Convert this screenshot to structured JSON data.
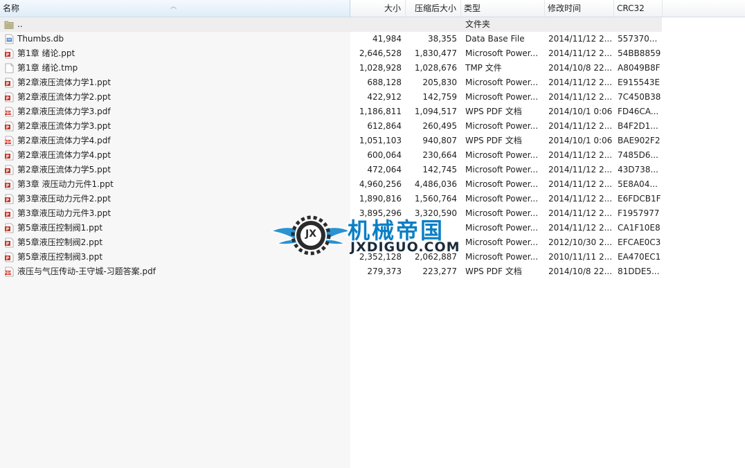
{
  "columns": {
    "name": "名称",
    "size": "大小",
    "packed": "压缩后大小",
    "type": "类型",
    "modified": "修改时间",
    "crc": "CRC32"
  },
  "parent_row": {
    "name": "..",
    "type": "文件夹",
    "icon": "folder-icon"
  },
  "files": [
    {
      "name": "Thumbs.db",
      "size": "41,984",
      "packed": "38,355",
      "type": "Data Base File",
      "modified": "2014/11/12 2...",
      "crc": "557370...",
      "icon": "db-file-icon"
    },
    {
      "name": "第1章  绪论.ppt",
      "size": "2,646,528",
      "packed": "1,830,477",
      "type": "Microsoft Power...",
      "modified": "2014/11/12 2...",
      "crc": "54BB8859",
      "icon": "ppt-file-icon"
    },
    {
      "name": "第1章  绪论.tmp",
      "size": "1,028,928",
      "packed": "1,028,676",
      "type": "TMP 文件",
      "modified": "2014/10/8 22...",
      "crc": "A8049B8F",
      "icon": "blank-file-icon"
    },
    {
      "name": "第2章液压流体力学1.ppt",
      "size": "688,128",
      "packed": "205,830",
      "type": "Microsoft Power...",
      "modified": "2014/11/12 2...",
      "crc": "E915543E",
      "icon": "ppt-file-icon"
    },
    {
      "name": "第2章液压流体力学2.ppt",
      "size": "422,912",
      "packed": "142,759",
      "type": "Microsoft Power...",
      "modified": "2014/11/12 2...",
      "crc": "7C450B38",
      "icon": "ppt-file-icon"
    },
    {
      "name": "第2章液压流体力学3.pdf",
      "size": "1,186,811",
      "packed": "1,094,517",
      "type": "WPS PDF 文档",
      "modified": "2014/10/1 0:06",
      "crc": "FD46CA...",
      "icon": "pdf-file-icon"
    },
    {
      "name": "第2章液压流体力学3.ppt",
      "size": "612,864",
      "packed": "260,495",
      "type": "Microsoft Power...",
      "modified": "2014/11/12 2...",
      "crc": "B4F2D1...",
      "icon": "ppt-file-icon"
    },
    {
      "name": "第2章液压流体力学4.pdf",
      "size": "1,051,103",
      "packed": "940,807",
      "type": "WPS PDF 文档",
      "modified": "2014/10/1 0:06",
      "crc": "BAE902F2",
      "icon": "pdf-file-icon"
    },
    {
      "name": "第2章液压流体力学4.ppt",
      "size": "600,064",
      "packed": "230,664",
      "type": "Microsoft Power...",
      "modified": "2014/11/12 2...",
      "crc": "7485D6...",
      "icon": "ppt-file-icon"
    },
    {
      "name": "第2章液压流体力学5.ppt",
      "size": "472,064",
      "packed": "142,745",
      "type": "Microsoft Power...",
      "modified": "2014/11/12 2...",
      "crc": "43D738...",
      "icon": "ppt-file-icon"
    },
    {
      "name": "第3章 液压动力元件1.ppt",
      "size": "4,960,256",
      "packed": "4,486,036",
      "type": "Microsoft Power...",
      "modified": "2014/11/12 2...",
      "crc": "5E8A04...",
      "icon": "ppt-file-icon"
    },
    {
      "name": "第3章液压动力元件2.ppt",
      "size": "1,890,816",
      "packed": "1,560,764",
      "type": "Microsoft Power...",
      "modified": "2014/11/12 2...",
      "crc": "E6FDCB1F",
      "icon": "ppt-file-icon"
    },
    {
      "name": "第3章液压动力元件3.ppt",
      "size": "3,895,296",
      "packed": "3,320,590",
      "type": "Microsoft Power...",
      "modified": "2014/11/12 2...",
      "crc": "F1957977",
      "icon": "ppt-file-icon"
    },
    {
      "name": "第5章液压控制阀1.ppt",
      "size": "",
      "packed": "",
      "type": "Microsoft Power...",
      "modified": "2014/11/12 2...",
      "crc": "CA1F10E8",
      "icon": "ppt-file-icon"
    },
    {
      "name": "第5章液压控制阀2.ppt",
      "size": "",
      "packed": "",
      "type": "Microsoft Power...",
      "modified": "2012/10/30 2...",
      "crc": "EFCAE0C3",
      "icon": "ppt-file-icon"
    },
    {
      "name": "第5章液压控制阀3.ppt",
      "size": "2,352,128",
      "packed": "2,062,887",
      "type": "Microsoft Power...",
      "modified": "2010/11/11 2...",
      "crc": "EA470EC1",
      "icon": "ppt-file-icon"
    },
    {
      "name": "液压与气压传动-王守城-习题答案.pdf",
      "size": "279,373",
      "packed": "223,277",
      "type": "WPS PDF 文档",
      "modified": "2014/10/8 22...",
      "crc": "81DDE5...",
      "icon": "pdf-file-icon"
    }
  ],
  "watermark": {
    "title": "机械帝国",
    "site": "JXDIGUO.COM",
    "emblem": "JX",
    "icon": "winged-gear-logo-icon"
  },
  "colors": {
    "ppt": "#c0392b",
    "pdf": "#d62b1f",
    "folder": "#b9b48a",
    "watermark_blue": "#0a7fc4"
  }
}
